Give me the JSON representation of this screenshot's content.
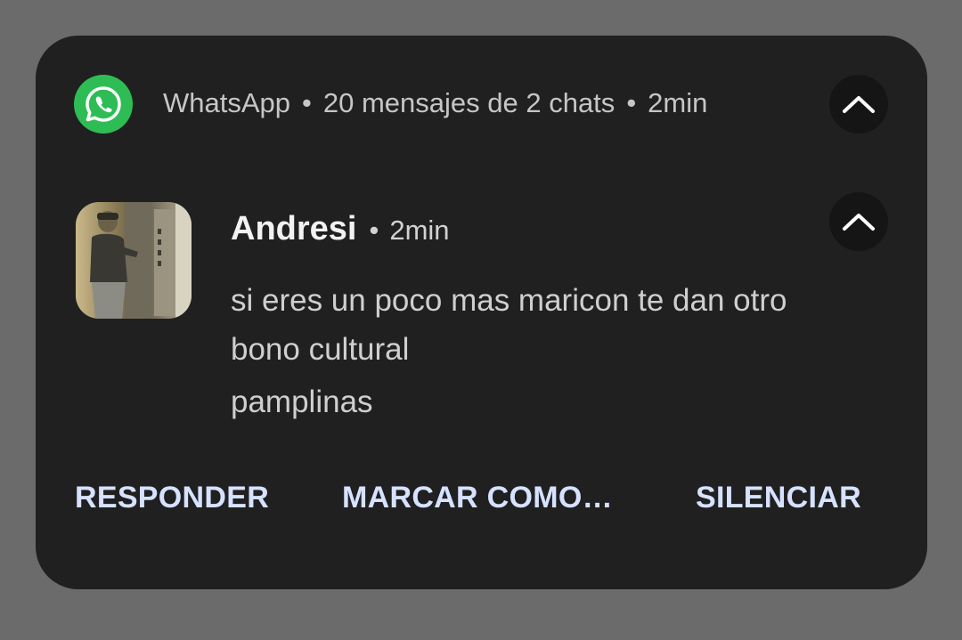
{
  "notification": {
    "app_name": "WhatsApp",
    "summary": "20 mensajes de 2 chats",
    "time": "2min",
    "separator": "•",
    "app_icon": "whatsapp-icon",
    "collapse_icon": "chevron-up-icon"
  },
  "message": {
    "sender": "Andresi",
    "time": "2min",
    "lines": [
      "si eres un poco mas maricon te dan otro",
      "bono cultural",
      "pamplinas"
    ],
    "avatar": "contact-avatar-photo"
  },
  "actions": {
    "reply": "RESPONDER",
    "mark_as": "MARCAR COMO…",
    "mute": "SILENCIAR"
  },
  "colors": {
    "background": "#6b6b6b",
    "card": "#202020",
    "whatsapp_green": "#2ebd55",
    "action_text": "#d6e2ff"
  }
}
